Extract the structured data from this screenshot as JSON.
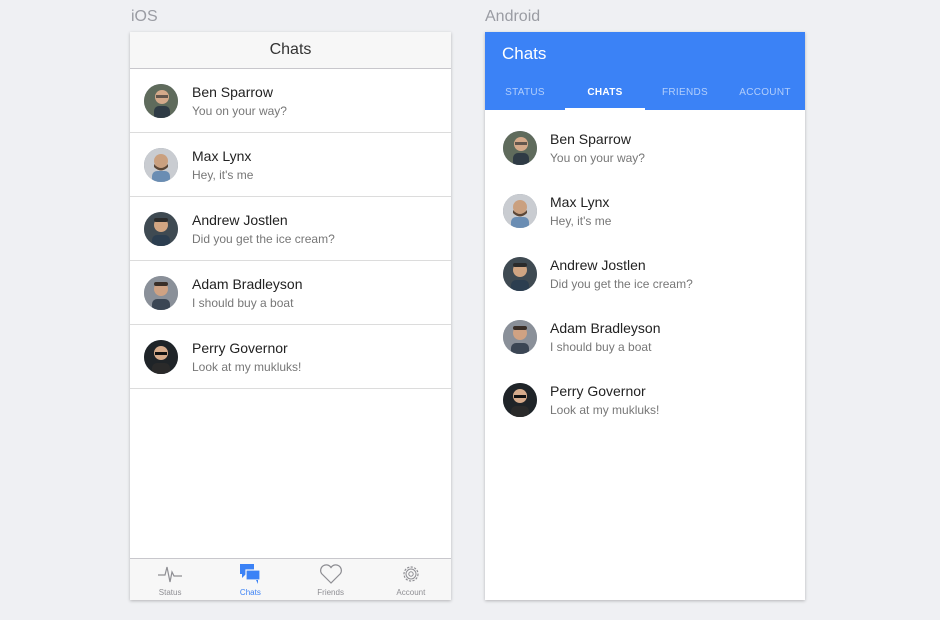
{
  "labels": {
    "ios": "iOS",
    "android": "Android"
  },
  "ios": {
    "title": "Chats",
    "tabs": [
      {
        "label": "Status",
        "icon": "pulse-icon"
      },
      {
        "label": "Chats",
        "icon": "chat-bubbles-icon",
        "active": true
      },
      {
        "label": "Friends",
        "icon": "heart-icon"
      },
      {
        "label": "Account",
        "icon": "gear-icon"
      }
    ]
  },
  "android": {
    "title": "Chats",
    "tabs": [
      {
        "label": "STATUS"
      },
      {
        "label": "CHATS",
        "active": true
      },
      {
        "label": "FRIENDS"
      },
      {
        "label": "ACCOUNT"
      }
    ]
  },
  "chats": [
    {
      "name": "Ben Sparrow",
      "message": "You on your way?"
    },
    {
      "name": "Max Lynx",
      "message": "Hey, it's me"
    },
    {
      "name": "Andrew Jostlen",
      "message": "Did you get the ice cream?"
    },
    {
      "name": "Adam Bradleyson",
      "message": "I should buy a boat"
    },
    {
      "name": "Perry Governor",
      "message": "Look at my mukluks!"
    }
  ],
  "colors": {
    "accent": "#3b82f6",
    "background": "#eff0f3"
  }
}
